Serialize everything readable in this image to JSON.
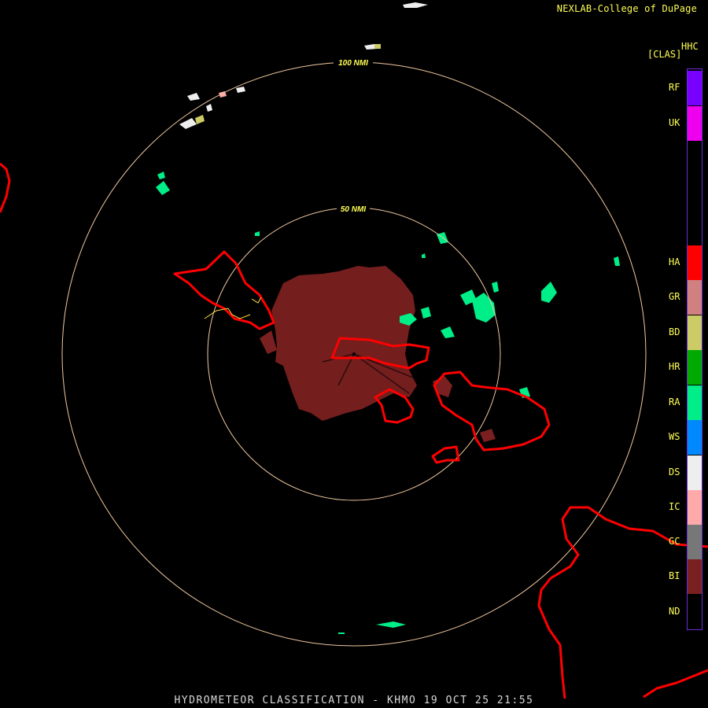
{
  "credit": "NEXLAB-College of DuPage",
  "caption": "HYDROMETEOR CLASSIFICATION - KHMO 19 OCT 25 21:55",
  "range_rings": [
    {
      "label": "100 NMI"
    },
    {
      "label": "50 NMI"
    }
  ],
  "legend": {
    "product": "HHC",
    "subtitle": "[CLAS]",
    "items": [
      {
        "code": "RF",
        "color": "#7700ff"
      },
      {
        "code": "UK",
        "color": "#ee00ee"
      },
      {
        "code": "HA",
        "color": "#ff0000"
      },
      {
        "code": "GR",
        "color": "#d08080"
      },
      {
        "code": "BD",
        "color": "#cccc66"
      },
      {
        "code": "HR",
        "color": "#00aa00"
      },
      {
        "code": "RA",
        "color": "#00ee88"
      },
      {
        "code": "WS",
        "color": "#0088ff"
      },
      {
        "code": "DS",
        "color": "#eeeeee"
      },
      {
        "code": "IC",
        "color": "#ffaaaa"
      },
      {
        "code": "GC",
        "color": "#777777"
      },
      {
        "code": "BI",
        "color": "#7a2020"
      },
      {
        "code": "ND",
        "color": "#000000"
      }
    ]
  },
  "colors": {
    "ring": "#f0c8a0",
    "warning_outline": "#ff0000",
    "ring_label": "#ffff55",
    "biological": "#7a2020",
    "rain": "#00ee88"
  }
}
